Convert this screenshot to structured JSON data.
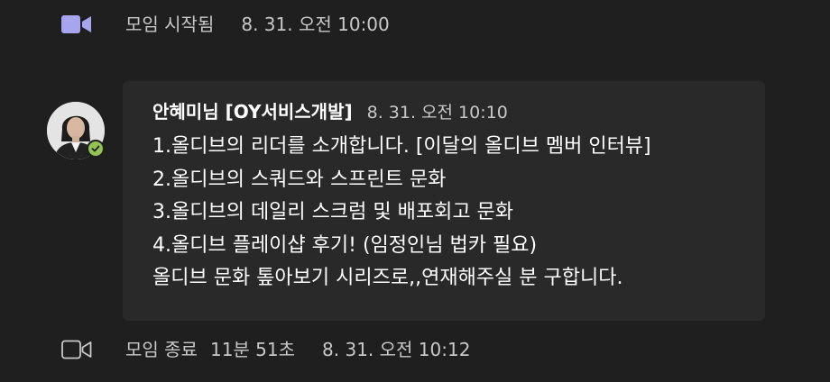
{
  "events": {
    "start": {
      "icon": "video-camera-filled-icon",
      "label": "모임 시작됨",
      "time": "8. 31. 오전 10:00"
    },
    "end": {
      "icon": "video-camera-outline-icon",
      "label": "모임 종료",
      "duration": "11분 51초",
      "time": "8. 31. 오전 10:12"
    }
  },
  "message": {
    "sender": "안혜미님 [OY서비스개발]",
    "timestamp": "8. 31. 오전 10:10",
    "presence": "available",
    "lines": [
      "1.올디브의 리더를 소개합니다. [이달의 올디브 멤버 인터뷰]",
      "2.올디브의 스쿼드와 스프린트 문화",
      "3.올디브의 데일리 스크럼 및 배포회고 문화",
      "4.올디브 플레이샵 후기! (임정인님 법카 필요)",
      "올디브 문화 톺아보기 시리즈로,,연재해주실 분 구합니다."
    ]
  },
  "colors": {
    "background": "#1f1f1f",
    "bubble": "#292929",
    "accent_purple": "#a8a5ef",
    "presence_green": "#92c353",
    "muted_text": "#c8c8c8"
  }
}
